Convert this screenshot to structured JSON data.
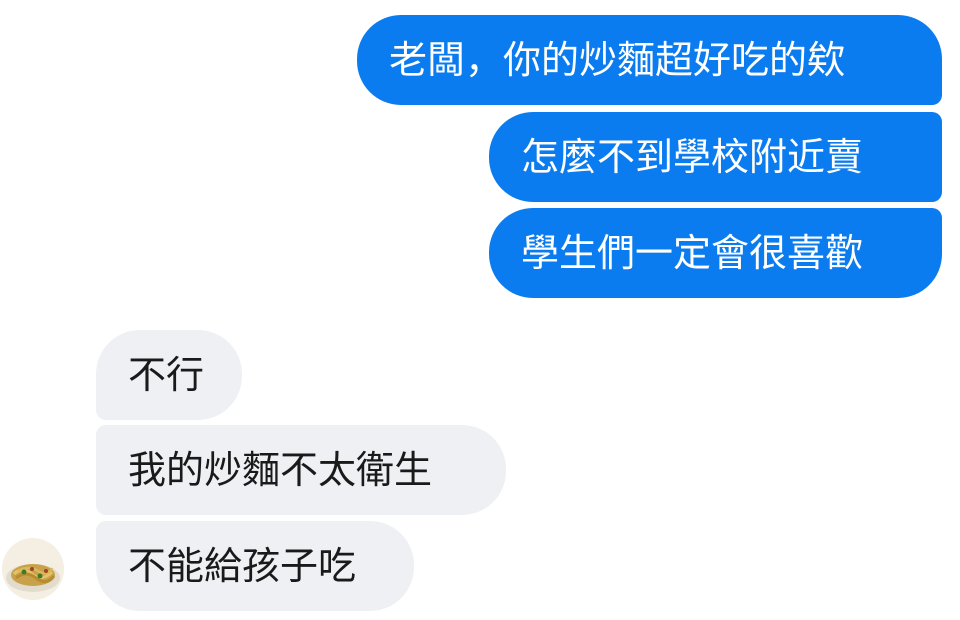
{
  "conversation": {
    "sent_messages": [
      {
        "text": "老闆，你的炒麵超好吃的欸"
      },
      {
        "text": "怎麼不到學校附近賣"
      },
      {
        "text": "學生們一定會很喜歡"
      }
    ],
    "received_messages": [
      {
        "text": "不行"
      },
      {
        "text": "我的炒麵不太衛生"
      },
      {
        "text": "不能給孩子吃"
      }
    ],
    "contact_avatar": {
      "icon": "fried-noodles-avatar-icon"
    }
  },
  "colors": {
    "sent_bubble": "#0b7cf0",
    "sent_text": "#ffffff",
    "received_bubble": "#eef0f3",
    "received_text": "#1a1a1a",
    "background": "#ffffff"
  }
}
